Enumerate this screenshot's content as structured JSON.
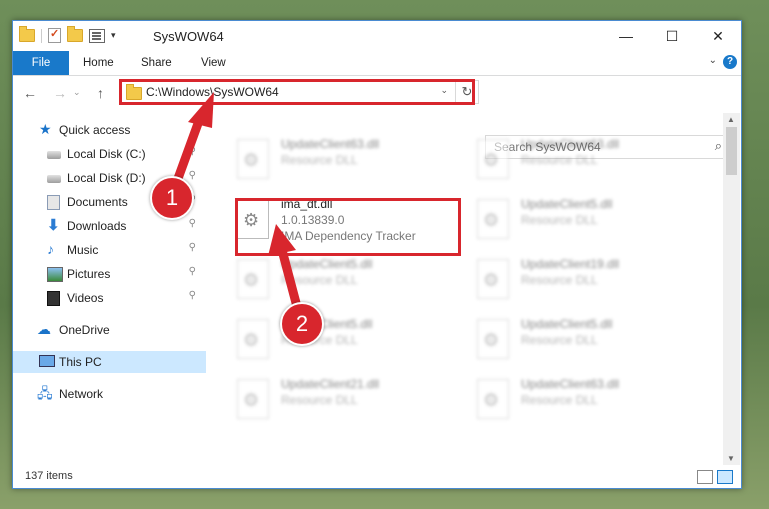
{
  "window": {
    "title": "SysWOW64",
    "minimize": "—",
    "maximize": "☐",
    "close": "✕"
  },
  "ribbon": {
    "tabs": [
      "File",
      "Home",
      "Share",
      "View"
    ],
    "toggle": "⌄",
    "help": "?"
  },
  "nav": {
    "back": "←",
    "forward": "→",
    "recent": "⌄",
    "up": "↑",
    "address": "C:\\Windows\\SysWOW64",
    "address_dropdown": "⌄",
    "refresh": "↻",
    "search_placeholder": "Search SysWOW64",
    "search_icon": "⌕"
  },
  "sidebar": {
    "items": [
      {
        "label": "Quick access",
        "icon": "star-icon",
        "pinned": false
      },
      {
        "label": "Local Disk (C:)",
        "icon": "disk-icon",
        "pinned": true
      },
      {
        "label": "Local Disk (D:)",
        "icon": "disk-icon",
        "pinned": true
      },
      {
        "label": "Documents",
        "icon": "documents-icon",
        "pinned": true
      },
      {
        "label": "Downloads",
        "icon": "downloads-icon",
        "pinned": true
      },
      {
        "label": "Music",
        "icon": "music-icon",
        "pinned": true
      },
      {
        "label": "Pictures",
        "icon": "pictures-icon",
        "pinned": true
      },
      {
        "label": "Videos",
        "icon": "videos-icon",
        "pinned": true
      },
      {
        "label": "OneDrive",
        "icon": "onedrive-icon",
        "pinned": false
      },
      {
        "label": "This PC",
        "icon": "this-pc-icon",
        "pinned": false,
        "selected": true
      },
      {
        "label": "Network",
        "icon": "network-icon",
        "pinned": false
      }
    ],
    "pin_glyph": "📌"
  },
  "files": {
    "main": {
      "name": "ima_dt.dll",
      "version": "1.0.13839.0",
      "description": "IMA Dependency Tracker"
    },
    "blurred": [
      {
        "name": "UpdateClient63.dll",
        "type": "Resource DLL"
      },
      {
        "name": "UpdateClient63.dll",
        "type": "Resource DLL"
      },
      {
        "name": "UpdateClient5.dll",
        "type": "Resource DLL"
      },
      {
        "name": "UpdateClient5.dll",
        "type": "Resource DLL"
      },
      {
        "name": "UpdateClient19.dll",
        "type": "Resource DLL"
      },
      {
        "name": "UpdateClient5.dll",
        "type": "Resource DLL"
      },
      {
        "name": "UpdateClient5.dll",
        "type": "Resource DLL"
      },
      {
        "name": "UpdateClient21.dll",
        "type": "Resource DLL"
      },
      {
        "name": "UpdateClient63.dll",
        "type": "Resource DLL"
      }
    ]
  },
  "status": {
    "item_count": "137 items"
  },
  "annotations": {
    "step1": "1",
    "step2": "2",
    "color": "#d8262d"
  }
}
